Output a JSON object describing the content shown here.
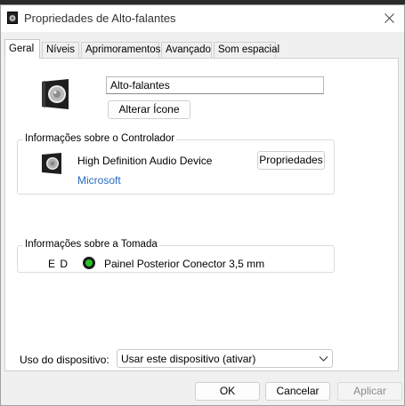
{
  "window": {
    "title": "Propriedades de Alto-falantes",
    "icon": "speaker-icon",
    "close_icon": "close-icon"
  },
  "tabs": [
    {
      "label": "Geral",
      "active": true
    },
    {
      "label": "Níveis",
      "active": false
    },
    {
      "label": "Aprimoramentos",
      "active": false
    },
    {
      "label": "Avançado",
      "active": false
    },
    {
      "label": "Som espacial",
      "active": false
    }
  ],
  "general": {
    "device_name_value": "Alto-falantes",
    "change_icon_label": "Alterar Ícone"
  },
  "controller": {
    "group_title": "Informações sobre o Controlador",
    "device": "High Definition Audio Device",
    "vendor": "Microsoft",
    "properties_label": "Propriedades",
    "vendor_color": "#2a6bbf"
  },
  "jack": {
    "group_title": "Informações sobre a Tomada",
    "position_code": "E D",
    "connector": "Painel Posterior Conector 3,5 mm",
    "jack_color": "#25c425"
  },
  "usage": {
    "label": "Uso do dispositivo:",
    "selected": "Usar este dispositivo (ativar)"
  },
  "footer": {
    "ok_label": "OK",
    "cancel_label": "Cancelar",
    "apply_label": "Aplicar"
  }
}
